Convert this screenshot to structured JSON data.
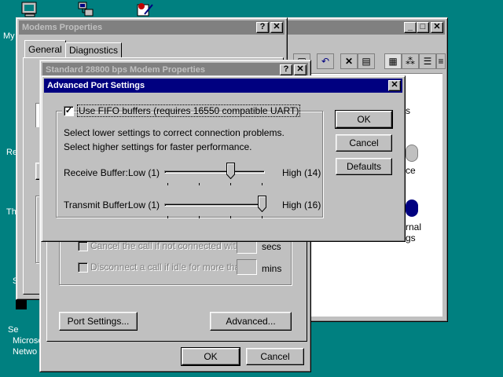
{
  "desktop": {
    "labels": [
      "My",
      "Re",
      "Th",
      "S",
      "Se",
      "Microso",
      "Netwo"
    ]
  },
  "control_panel": {
    "items": [
      "s",
      "ce",
      "rnal",
      "gs"
    ]
  },
  "modems_properties": {
    "title": "Modems Properties",
    "tabs": [
      "General",
      "Diagnostics"
    ]
  },
  "modem_props": {
    "title": "Standard 28800 bps Modem Properties",
    "cancel_call_label": "Cancel the call if not connected within",
    "cancel_call_unit": "secs",
    "disconnect_idle_label": "Disconnect a call if idle for more than",
    "disconnect_idle_unit": "mins",
    "port_settings_button": "Port Settings...",
    "advanced_button": "Advanced...",
    "ok_button": "OK",
    "cancel_button": "Cancel"
  },
  "advanced_port": {
    "title": "Advanced Port Settings",
    "fifo_label": "Use FIFO buffers (requires 16550 compatible UART)",
    "fifo_checked": true,
    "hint_lower": "Select lower settings to correct connection problems.",
    "hint_higher": "Select higher settings for faster performance.",
    "receive": {
      "label": "Receive Buffer:",
      "low": "Low (1)",
      "high": "High (14)",
      "level": 0.67
    },
    "transmit": {
      "label": "Transmit Buffer:",
      "low": "Low (1)",
      "high": "High (16)",
      "level": 1.0
    },
    "ok_button": "OK",
    "cancel_button": "Cancel",
    "defaults_button": "Defaults"
  },
  "titlebar_buttons": {
    "help": "?",
    "close": "✕",
    "minimize": "_",
    "maximize": "□"
  }
}
